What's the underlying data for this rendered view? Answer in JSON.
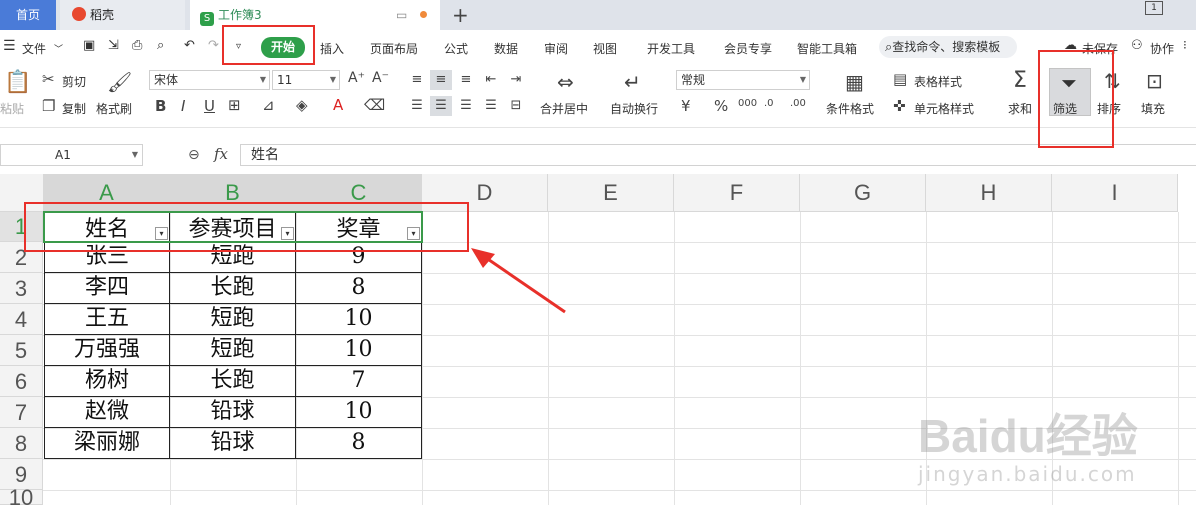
{
  "tabs": [
    {
      "label": "首页"
    },
    {
      "label": "稻壳"
    },
    {
      "label": "工作簿3"
    }
  ],
  "menu": {
    "file": "文件",
    "start": "开始",
    "items": [
      "插入",
      "页面布局",
      "公式",
      "数据",
      "审阅",
      "视图",
      "开发工具",
      "会员专享",
      "智能工具箱"
    ],
    "search": "查找命令、搜索模板",
    "unsaved": "未保存",
    "collab": "协作"
  },
  "ribbon": {
    "paste": "粘贴",
    "cut": "剪切",
    "copy": "复制",
    "format_painter": "格式刷",
    "font_name": "宋体",
    "font_size": "11",
    "merge_center": "合并居中",
    "wrap": "自动换行",
    "number_format": "常规",
    "cond_format": "条件格式",
    "table_style": "表格样式",
    "cell_style": "单元格样式",
    "sum": "求和",
    "filter": "筛选",
    "sort": "排序",
    "fill": "填充"
  },
  "formula_bar": {
    "name_box": "A1",
    "fx": "fx",
    "content": "姓名"
  },
  "columns": [
    "A",
    "B",
    "C",
    "D",
    "E",
    "F",
    "G",
    "H",
    "I"
  ],
  "rows": [
    "1",
    "2",
    "3",
    "4",
    "5",
    "6",
    "7",
    "8",
    "9",
    "10"
  ],
  "table": {
    "headers": [
      "姓名",
      "参赛项目",
      "奖章"
    ],
    "rows": [
      [
        "张三",
        "短跑",
        "9"
      ],
      [
        "李四",
        "长跑",
        "8"
      ],
      [
        "王五",
        "短跑",
        "10"
      ],
      [
        "万强强",
        "短跑",
        "10"
      ],
      [
        "杨树",
        "长跑",
        "7"
      ],
      [
        "赵微",
        "铅球",
        "10"
      ],
      [
        "梁丽娜",
        "铅球",
        "8"
      ]
    ]
  },
  "watermark": {
    "brand": "Baidu经验",
    "url": "jingyan.baidu.com"
  },
  "colors": {
    "accent_green": "#2e9f4a",
    "annotation_red": "#e8302a",
    "tab_blue": "#4a7bd8"
  }
}
